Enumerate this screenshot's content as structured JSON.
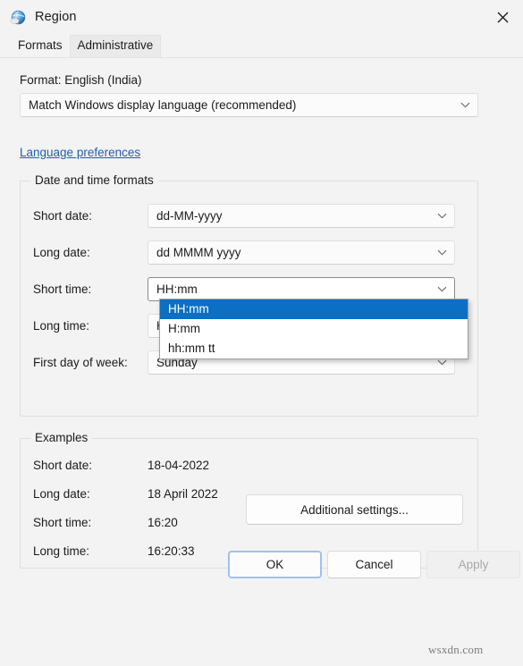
{
  "window": {
    "title": "Region",
    "icon": "globe-icon",
    "close_label": "✕"
  },
  "tabs": [
    {
      "label": "Formats",
      "active": true
    },
    {
      "label": "Administrative",
      "active": false
    }
  ],
  "formats": {
    "format_label": "Format: English (India)",
    "format_combo_value": "Match Windows display language (recommended)",
    "language_preferences_link": "Language preferences"
  },
  "datetime_group": {
    "title": "Date and time formats",
    "rows": [
      {
        "label": "Short date:",
        "value": "dd-MM-yyyy"
      },
      {
        "label": "Long date:",
        "value": "dd MMMM yyyy"
      },
      {
        "label": "Short time:",
        "value": "HH:mm"
      },
      {
        "label": "Long time:",
        "value": "HH:mm:ss"
      },
      {
        "label": "First day of week:",
        "value": "Sunday"
      }
    ]
  },
  "short_time_dropdown": {
    "open": true,
    "options": [
      {
        "label": "HH:mm",
        "selected": true
      },
      {
        "label": "H:mm",
        "selected": false
      },
      {
        "label": "hh:mm tt",
        "selected": false
      }
    ]
  },
  "examples_group": {
    "title": "Examples",
    "rows": [
      {
        "label": "Short date:",
        "value": "18-04-2022"
      },
      {
        "label": "Long date:",
        "value": "18 April 2022"
      },
      {
        "label": "Short time:",
        "value": "16:20"
      },
      {
        "label": "Long time:",
        "value": "16:20:33"
      }
    ]
  },
  "buttons": {
    "additional_settings": "Additional settings...",
    "ok": "OK",
    "cancel": "Cancel",
    "apply": "Apply"
  },
  "watermark": "wsxdn.com",
  "colors": {
    "accent_selection": "#0b6fc4",
    "link": "#1c5fb5",
    "window_background": "#f3f3f3",
    "focus_border": "#9fc2e7"
  }
}
